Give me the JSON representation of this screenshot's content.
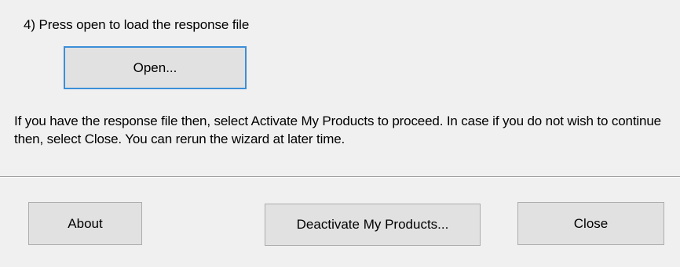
{
  "step": {
    "label": "4)  Press open to load the response file"
  },
  "buttons": {
    "open_label": "Open...",
    "about_label": "About",
    "deactivate_label": "Deactivate My Products...",
    "close_label": "Close"
  },
  "info": {
    "text": "If you have the response file then, select Activate My Products to proceed.  In case if you do not wish to continue then, select Close. You can rerun the wizard at later time."
  },
  "colors": {
    "background": "#f0f0f0",
    "button_face": "#e1e1e1",
    "button_border": "#adadad",
    "focus_border": "#3c8ed9",
    "separator": "#a0a0a0"
  }
}
